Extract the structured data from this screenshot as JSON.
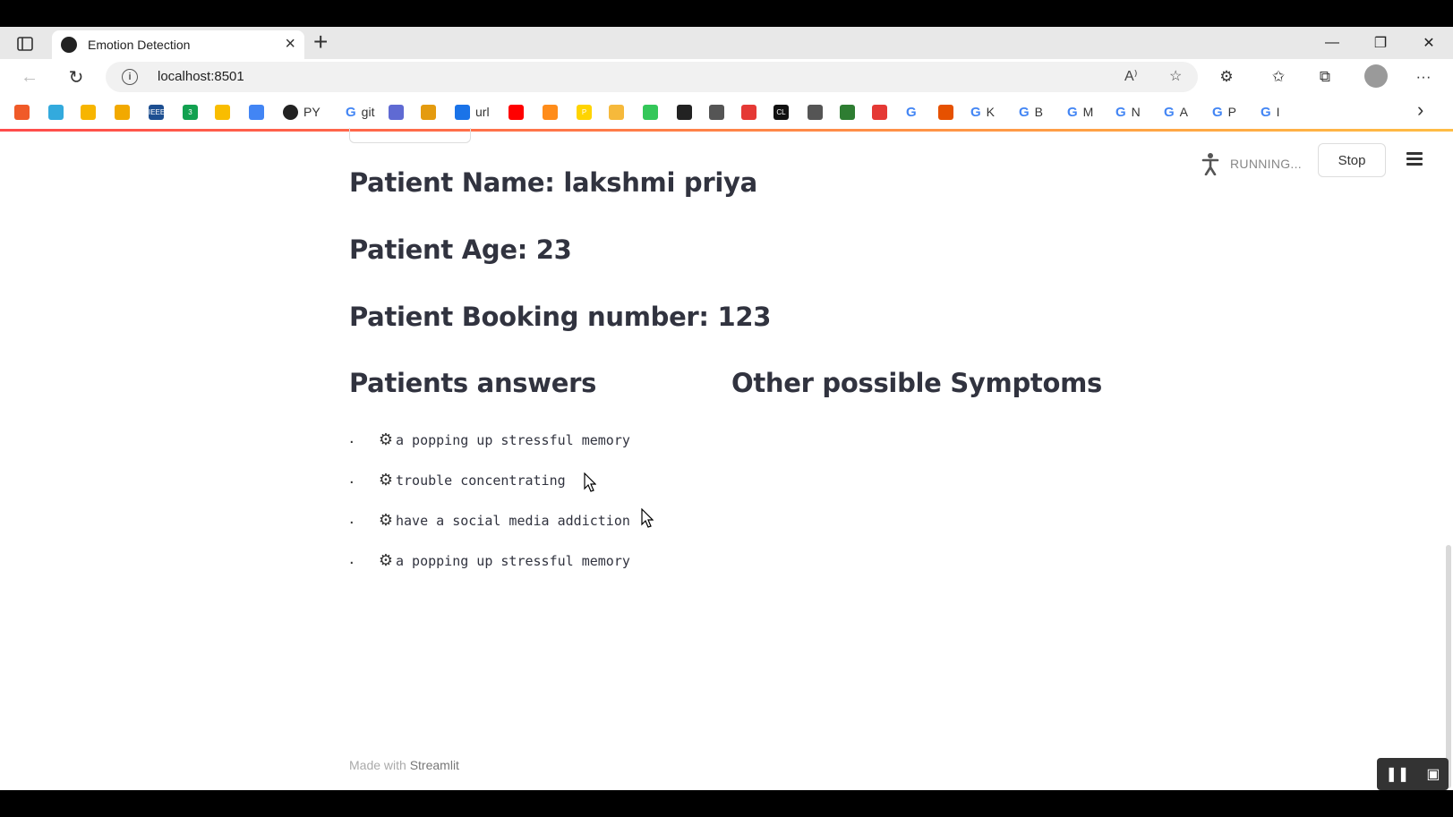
{
  "browser": {
    "tab_title": "Emotion Detection",
    "url": "localhost:8501",
    "bookmarks": [
      {
        "icon": "",
        "label": ""
      },
      {
        "icon": "",
        "label": ""
      },
      {
        "icon": "",
        "label": ""
      },
      {
        "icon": "",
        "label": ""
      },
      {
        "icon": "IEEE",
        "label": ""
      },
      {
        "icon": "3",
        "label": ""
      },
      {
        "icon": "",
        "label": ""
      },
      {
        "icon": "",
        "label": ""
      },
      {
        "icon": "github",
        "label": "PY"
      },
      {
        "icon": "G",
        "label": "git"
      },
      {
        "icon": "",
        "label": ""
      },
      {
        "icon": "",
        "label": ""
      },
      {
        "icon": "",
        "label": "url"
      },
      {
        "icon": "",
        "label": ""
      },
      {
        "icon": "",
        "label": ""
      },
      {
        "icon": "P",
        "label": ""
      },
      {
        "icon": "",
        "label": ""
      },
      {
        "icon": "",
        "label": ""
      },
      {
        "icon": "",
        "label": ""
      },
      {
        "icon": "",
        "label": ""
      },
      {
        "icon": "",
        "label": ""
      },
      {
        "icon": "CL",
        "label": ""
      },
      {
        "icon": "",
        "label": ""
      },
      {
        "icon": "",
        "label": ""
      },
      {
        "icon": "",
        "label": ""
      },
      {
        "icon": "G",
        "label": ""
      },
      {
        "icon": "",
        "label": ""
      },
      {
        "icon": "G",
        "label": "K"
      },
      {
        "icon": "G",
        "label": "B"
      },
      {
        "icon": "G",
        "label": "M"
      },
      {
        "icon": "G",
        "label": "N"
      },
      {
        "icon": "G",
        "label": "A"
      },
      {
        "icon": "G",
        "label": "P"
      },
      {
        "icon": "G",
        "label": "I"
      }
    ]
  },
  "app": {
    "status": "RUNNING...",
    "stop_label": "Stop",
    "patient_name": "Patient Name: lakshmi priya",
    "patient_age": "Patient Age: 23",
    "patient_booking": "Patient Booking number: 123",
    "answers_heading": "Patients answers",
    "symptoms_heading": "Other possible Symptoms",
    "answers": [
      "a popping up stressful memory",
      "trouble concentrating",
      "have a social media addiction",
      "a popping up stressful memory"
    ],
    "footer_prefix": "Made with",
    "footer_brand": "Streamlit"
  },
  "colors": {
    "accent": "#ff4b4b",
    "heading": "#31333f"
  }
}
